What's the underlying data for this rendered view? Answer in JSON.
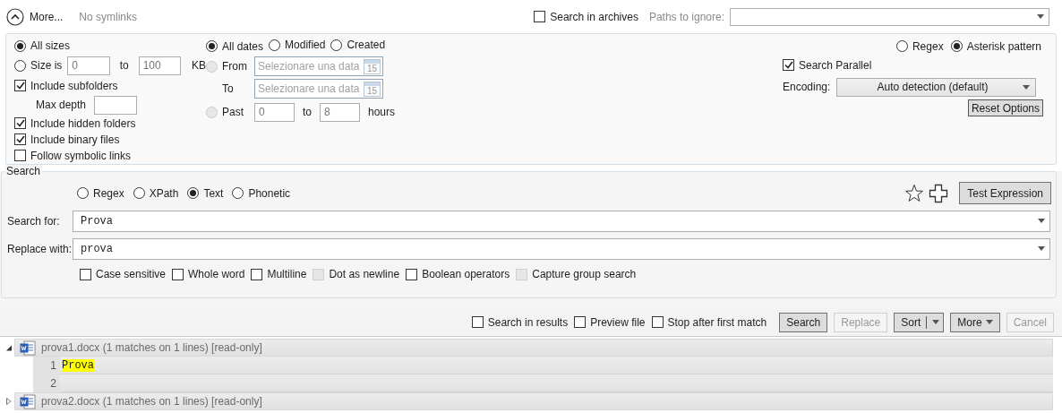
{
  "header": {
    "more": "More...",
    "symlinks": "No symlinks",
    "archives": {
      "label": "Search in archives",
      "checked": false
    },
    "ignore_label": "Paths to ignore:"
  },
  "filters": {
    "size_modes": [
      {
        "label": "All sizes",
        "selected": true
      },
      {
        "label": "Size is",
        "selected": false
      }
    ],
    "size_range": {
      "from": "0",
      "to_label": "to",
      "to": "100",
      "unit": "KB"
    },
    "subfolders": {
      "label": "Include subfolders",
      "checked": true
    },
    "max_depth_label": "Max depth",
    "flags": [
      {
        "label": "Include hidden folders",
        "checked": true
      },
      {
        "label": "Include binary files",
        "checked": true
      },
      {
        "label": "Follow symbolic links",
        "checked": false
      }
    ],
    "date_modes": [
      {
        "label": "All dates",
        "selected": true
      },
      {
        "label": "Modified",
        "selected": false
      },
      {
        "label": "Created",
        "selected": false
      }
    ],
    "from": {
      "label": "From",
      "selected": false,
      "disabled": true,
      "placeholder": "Selezionare una data",
      "day": "15"
    },
    "to": {
      "label": "To",
      "placeholder": "Selezionare una data",
      "day": "15"
    },
    "past": {
      "label": "Past",
      "selected": false,
      "disabled": true,
      "from": "0",
      "to_label": "to",
      "to": "8",
      "unit": "hours"
    },
    "pattern_modes": [
      {
        "label": "Regex",
        "selected": false
      },
      {
        "label": "Asterisk pattern",
        "selected": true
      }
    ],
    "search_parallel": {
      "label": "Search Parallel",
      "checked": true
    },
    "encoding_label": "Encoding:",
    "encoding_value": "Auto detection (default)",
    "reset": "Reset Options"
  },
  "search": {
    "legend": "Search",
    "types": [
      {
        "label": "Regex",
        "selected": false
      },
      {
        "label": "XPath",
        "selected": false
      },
      {
        "label": "Text",
        "selected": true
      },
      {
        "label": "Phonetic",
        "selected": false
      }
    ],
    "test_button": "Test Expression",
    "search_for_label": "Search for:",
    "search_for_value": "Prova",
    "replace_label": "Replace with:",
    "replace_value": "prova",
    "options": [
      {
        "label": "Case sensitive",
        "checked": false,
        "disabled": false
      },
      {
        "label": "Whole word",
        "checked": false,
        "disabled": false
      },
      {
        "label": "Multiline",
        "checked": false,
        "disabled": false
      },
      {
        "label": "Dot as newline",
        "checked": false,
        "disabled": true
      },
      {
        "label": "Boolean operators",
        "checked": false,
        "disabled": false
      },
      {
        "label": "Capture group search",
        "checked": false,
        "disabled": true
      }
    ]
  },
  "actions": {
    "checks": [
      {
        "label": "Search in results",
        "checked": false
      },
      {
        "label": "Preview file",
        "checked": false
      },
      {
        "label": "Stop after first match",
        "checked": false
      }
    ],
    "buttons": [
      {
        "label": "Search",
        "kind": "plain",
        "disabled": false
      },
      {
        "label": "Replace",
        "kind": "plain",
        "disabled": true
      },
      {
        "label": "Sort",
        "kind": "split",
        "disabled": false
      },
      {
        "label": "More",
        "kind": "menu",
        "disabled": false
      },
      {
        "label": "Cancel",
        "kind": "plain",
        "disabled": true
      }
    ]
  },
  "results": [
    {
      "file": "prova1.docx (1 matches on 1 lines) [read-only]",
      "expanded": true,
      "lines": [
        {
          "number": "1",
          "text": "Prova"
        },
        {
          "number": "2"
        }
      ]
    },
    {
      "file": "prova2.docx (1 matches on 1 lines) [read-only]",
      "expanded": false
    }
  ]
}
